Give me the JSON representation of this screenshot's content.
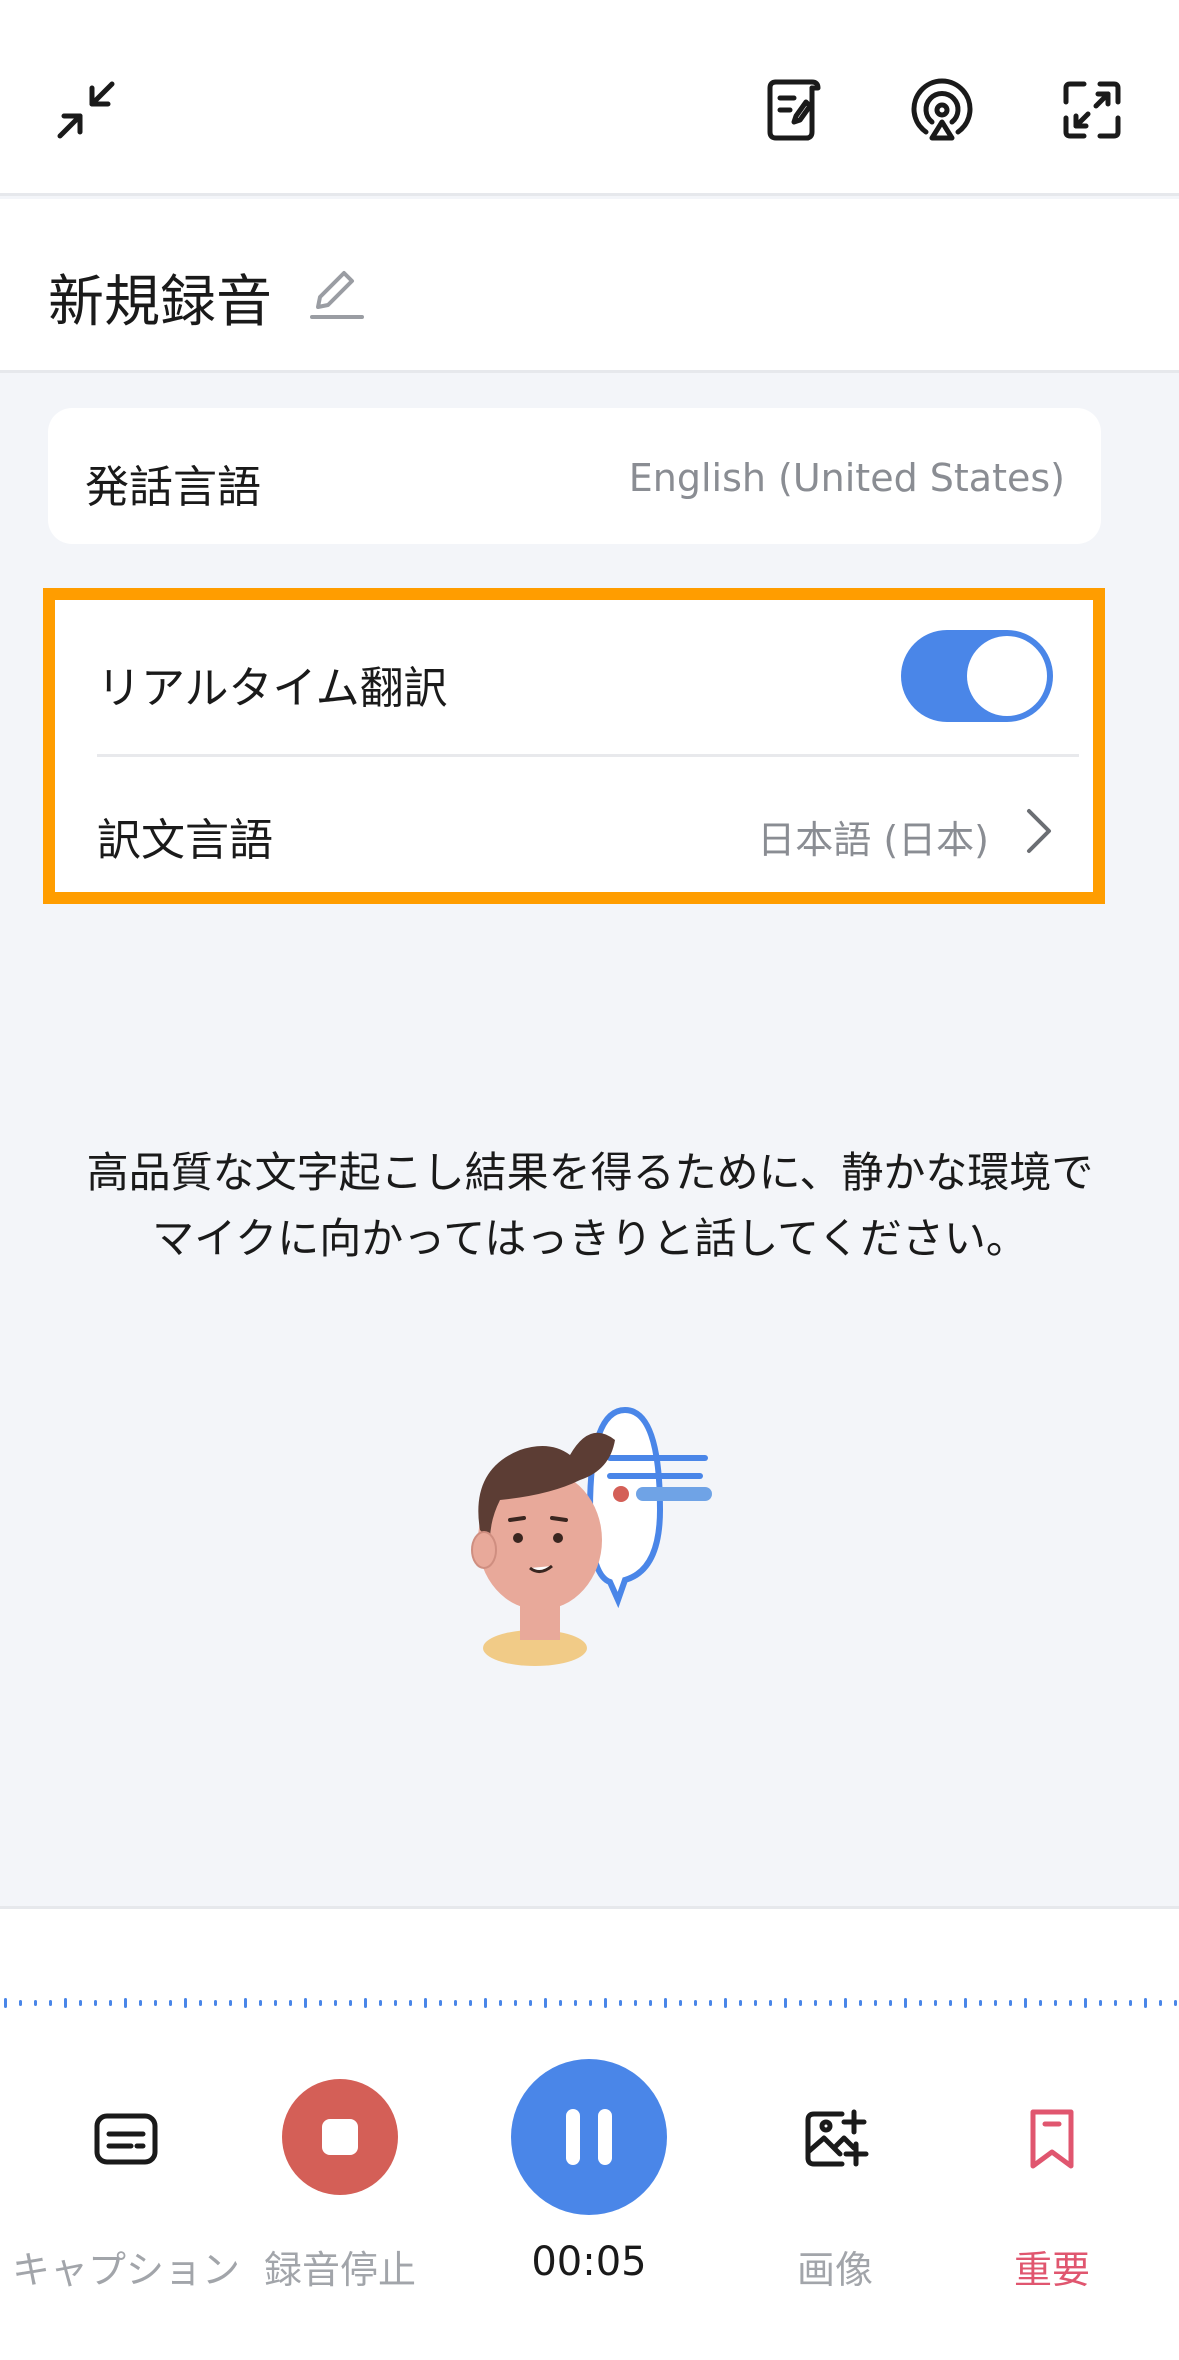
{
  "header": {
    "icons": [
      "collapse-icon",
      "notes-icon",
      "broadcast-icon",
      "expand-icon"
    ]
  },
  "recording": {
    "title": "新規録音"
  },
  "speech_language": {
    "label": "発話言語",
    "value": "English (United States)"
  },
  "translation": {
    "realtime_label": "リアルタイム翻訳",
    "realtime_enabled": true,
    "target_label": "訳文言語",
    "target_value": "日本語 (日本)"
  },
  "hint": {
    "text": "高品質な文字起こし結果を得るために、静かな環境でマイクに向かってはっきりと話してください。"
  },
  "toolbar": {
    "caption_label": "キャプション",
    "stop_label": "録音停止",
    "timer": "00:05",
    "image_label": "画像",
    "important_label": "重要"
  },
  "colors": {
    "accent_blue": "#4a86e8",
    "stop_red": "#d45f57",
    "highlight_orange": "#ff9d00",
    "important_pink": "#e0566f"
  }
}
